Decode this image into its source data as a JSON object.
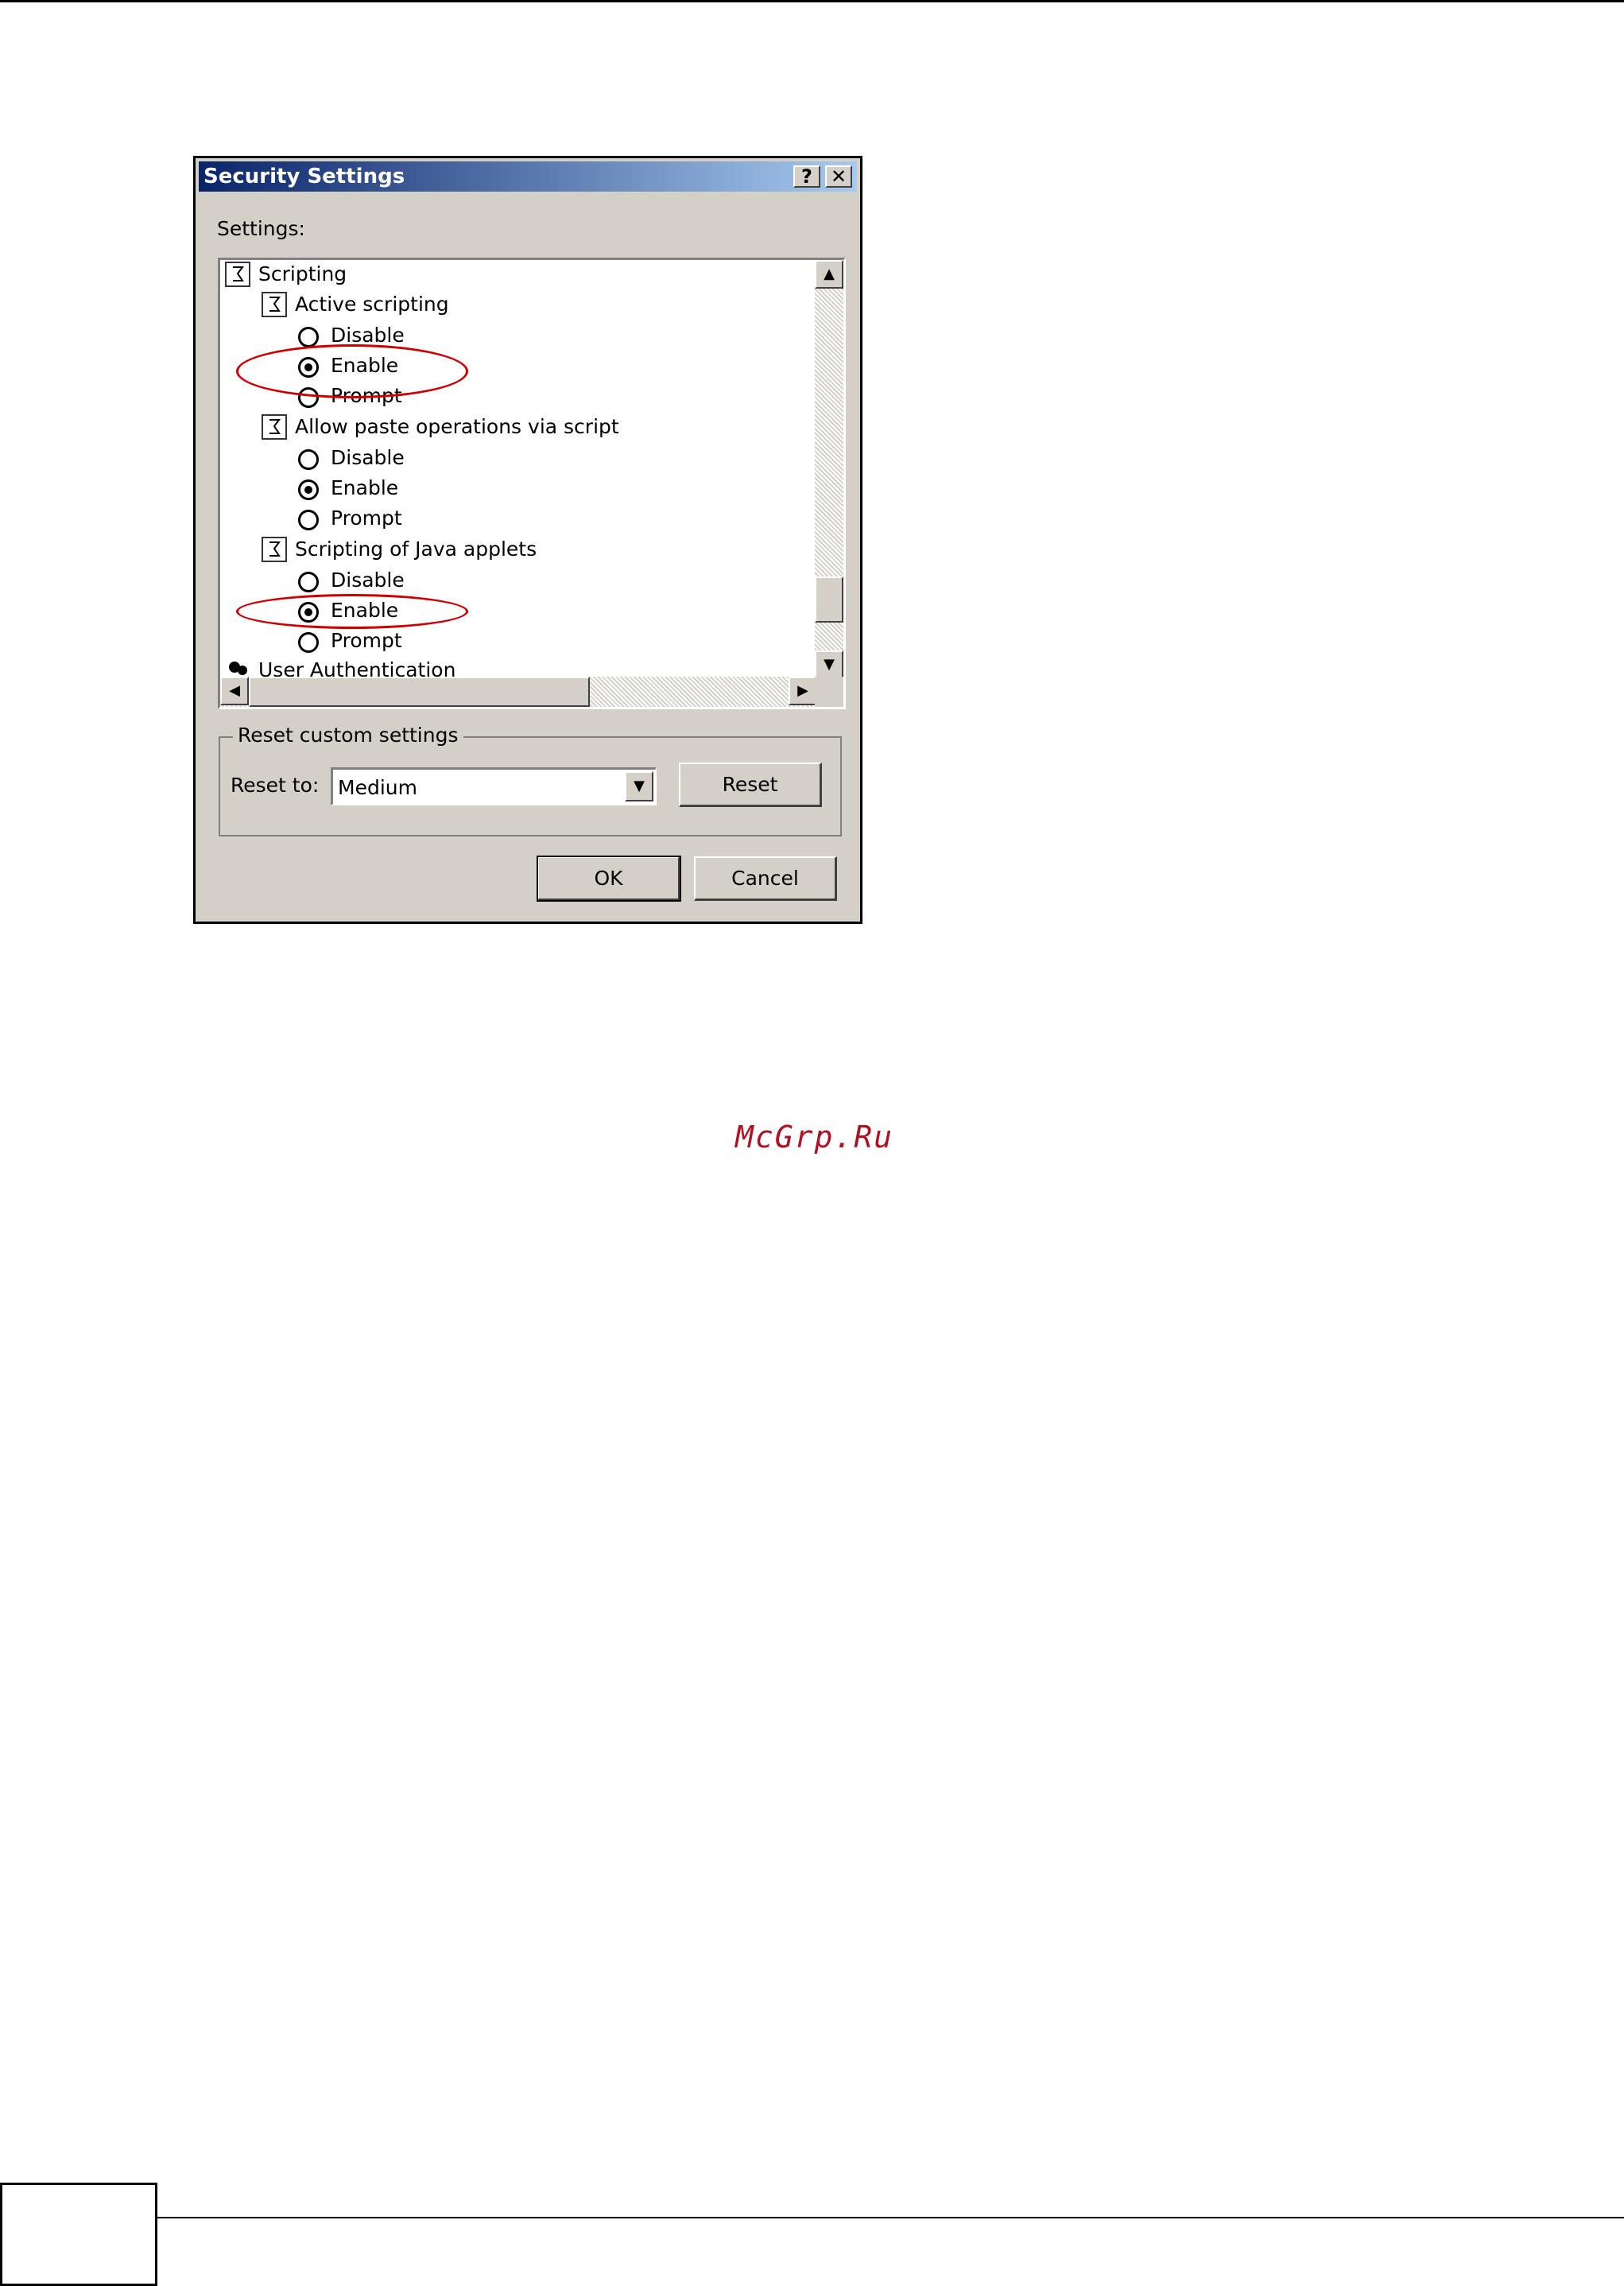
{
  "dialog": {
    "title": "Security Settings",
    "help_glyph": "?",
    "close_glyph": "✕",
    "settings_label": "Settings:"
  },
  "tree": {
    "scripting": "Scripting",
    "active_scripting": {
      "label": "Active scripting",
      "options": [
        "Disable",
        "Enable",
        "Prompt"
      ],
      "selected": "Enable"
    },
    "paste": {
      "label": "Allow paste operations via script",
      "options": [
        "Disable",
        "Enable",
        "Prompt"
      ],
      "selected": "Enable"
    },
    "java": {
      "label": "Scripting of Java applets",
      "options": [
        "Disable",
        "Enable",
        "Prompt"
      ],
      "selected": "Enable"
    },
    "user_auth": "User Authentication"
  },
  "reset_group": {
    "title": "Reset custom settings",
    "reset_to_label": "Reset to:",
    "reset_to_value": "Medium",
    "reset_button": "Reset"
  },
  "buttons": {
    "ok": "OK",
    "cancel": "Cancel"
  },
  "watermark": "McGrp.Ru",
  "colors": {
    "title_start": "#0a246a",
    "title_end": "#a6caf0",
    "highlight": "#d00000",
    "dialog_bg": "#d4d0c8"
  }
}
